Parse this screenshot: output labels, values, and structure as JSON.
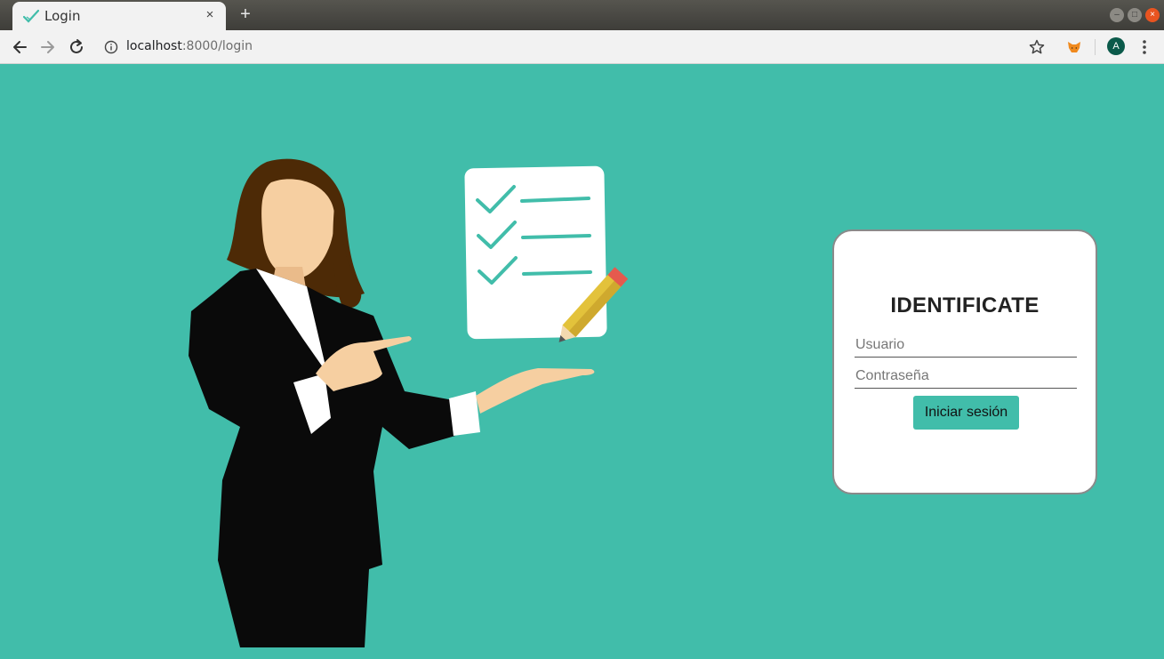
{
  "browser": {
    "tab_title": "Login",
    "tab_close": "×",
    "new_tab": "+",
    "url_host": "localhost",
    "url_rest": ":8000/login",
    "avatar_initial": "A"
  },
  "login": {
    "title": "IDENTIFICATE",
    "username_placeholder": "Usuario",
    "password_placeholder": "Contraseña",
    "submit_label": "Iniciar sesión"
  },
  "colors": {
    "page_background": "#41bdaa",
    "button_background": "#41bdaa",
    "card_background": "#ffffff"
  }
}
